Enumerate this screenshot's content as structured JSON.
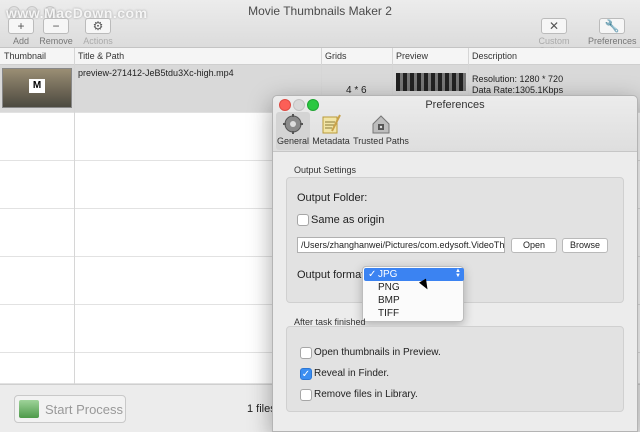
{
  "app": {
    "title": "Movie Thumbnails Maker 2",
    "watermark": "www.MacDown.com"
  },
  "toolbar": {
    "add_label": "Add",
    "remove_label": "Remove",
    "actions_label": "Actions",
    "custom_collage_label": "Custom Collage",
    "preferences_label": "Preferences"
  },
  "table": {
    "columns": [
      "Thumbnail",
      "Title & Path",
      "Grids",
      "Preview",
      "Description"
    ],
    "rows": [
      {
        "title": "preview-271412-JeB5tdu3Xc-high.mp4",
        "grids": "4 * 6",
        "resolution": "Resolution: 1280 * 720",
        "data_rate": "Data Rate:1305.1Kbps"
      }
    ]
  },
  "bottom": {
    "start_label": "Start Process",
    "files_count": "1 files"
  },
  "preferences": {
    "title": "Preferences",
    "tabs": [
      {
        "label": "General",
        "icon": "gear-icon"
      },
      {
        "label": "Metadata",
        "icon": "metadata-icon"
      },
      {
        "label": "Trusted Paths",
        "icon": "lock-house-icon"
      }
    ],
    "output_settings_label": "Output Settings",
    "output_folder_label": "Output Folder:",
    "same_as_origin_label": "Same as origin",
    "folder_path": "/Users/zhanghanwei/Pictures/com.edysoft.VideoThumbnailMaker",
    "open_label": "Open",
    "browse_label": "Browse",
    "output_format_label": "Output format:",
    "format_options": [
      "JPG",
      "PNG",
      "BMP",
      "TIFF"
    ],
    "after_task_label": "After task finished",
    "after_options": [
      {
        "label": "Open thumbnails in Preview.",
        "checked": false
      },
      {
        "label": "Reveal in Finder.",
        "checked": true
      },
      {
        "label": "Remove files in Library.",
        "checked": false
      }
    ]
  }
}
